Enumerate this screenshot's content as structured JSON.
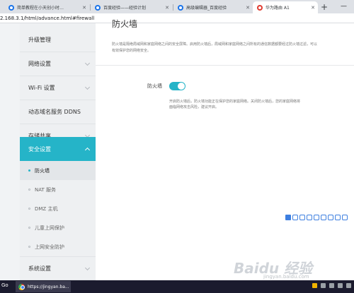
{
  "browser": {
    "tabs": [
      {
        "label": "简单教程在小天创小时…",
        "icon": "globe-icon"
      },
      {
        "label": "百度经验——经验计划",
        "icon": "globe-icon"
      },
      {
        "label": "高级编辑器_百度经验",
        "icon": "globe-icon"
      },
      {
        "label": "华为路由 A1",
        "icon": "huawei-icon"
      }
    ],
    "new_tab": "+",
    "minimize": "—",
    "url": "2.168.3.1/html/advance.html#firewall"
  },
  "sidebar": {
    "items": [
      {
        "label": "升级管理"
      },
      {
        "label": "网络设置"
      },
      {
        "label": "Wi-Fi 设置"
      },
      {
        "label": "动态域名服务 DDNS"
      },
      {
        "label": "存储共享"
      },
      {
        "label": "安全设置"
      },
      {
        "label": "系统设置"
      }
    ],
    "sub_items": [
      {
        "label": "防火墙"
      },
      {
        "label": "NAT 服务"
      },
      {
        "label": "DMZ 主机"
      },
      {
        "label": "儿童上网保护"
      },
      {
        "label": "上网安全防护"
      }
    ]
  },
  "content": {
    "title": "防火墙",
    "description": "防火墙是隔绝局域网和家庭网络之间的安全屏障。启用防火墙后，局域网和家庭网络之间所有的通信数据都要经过防火墙过滤，可以有效保护您的网络安全。",
    "firewall_label": "防火墙",
    "firewall_enabled": true,
    "firewall_desc": "开启防火墙后，防火墙功能正在保护您的家庭网络。关闭防火墙后，您的家庭网络将面临网络攻击风险，建议开启。"
  },
  "watermark": {
    "brand": "Baidu 经验",
    "url": "jingyan.baidu.com"
  },
  "taskbar": {
    "start": "Go",
    "app_label": "https://jingyan.ba..."
  }
}
